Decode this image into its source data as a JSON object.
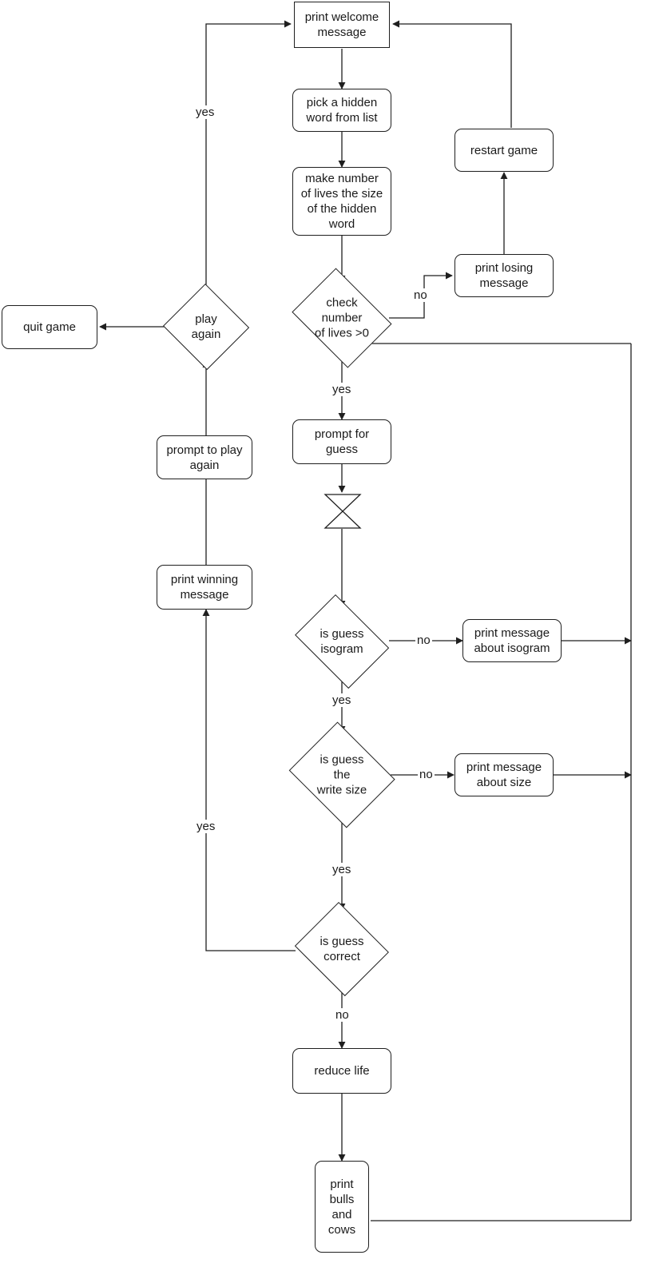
{
  "diagram": {
    "title": "Word guessing game flowchart",
    "stroke_color": "#1f1f1f",
    "text_color": "#1a1a1a",
    "background_color": "#ffffff"
  },
  "nodes": {
    "welcome": {
      "label": "print welcome\nmessage",
      "shape": "rectangle"
    },
    "pick_word": {
      "label": "pick a hidden\nword from list",
      "shape": "rounded-rectangle"
    },
    "set_lives": {
      "label": "make number\nof lives the size\nof the hidden\nword",
      "shape": "rounded-rectangle"
    },
    "check_lives": {
      "label": "check number\nof lives >0",
      "shape": "decision"
    },
    "print_losing": {
      "label": "print losing\nmessage",
      "shape": "rounded-rectangle"
    },
    "restart_game": {
      "label": "restart game",
      "shape": "rounded-rectangle"
    },
    "play_again": {
      "label": "play again",
      "shape": "decision"
    },
    "quit_game": {
      "label": "quit game",
      "shape": "rounded-rectangle"
    },
    "prompt_play": {
      "label": "prompt to play\nagain",
      "shape": "rounded-rectangle"
    },
    "print_winning": {
      "label": "print winning\nmessage",
      "shape": "rounded-rectangle"
    },
    "prompt_guess": {
      "label": "prompt for\nguess",
      "shape": "rounded-rectangle"
    },
    "input_guess": {
      "label": "",
      "shape": "hourglass"
    },
    "is_isogram": {
      "label": "is guess\nisogram",
      "shape": "decision"
    },
    "msg_isogram": {
      "label": "print message\nabout isogram",
      "shape": "rounded-rectangle"
    },
    "is_right_size": {
      "label": "is guess the\nwrite size",
      "shape": "decision"
    },
    "msg_size": {
      "label": "print message\nabout size",
      "shape": "rounded-rectangle"
    },
    "is_correct": {
      "label": "is guess\ncorrect",
      "shape": "decision"
    },
    "reduce_life": {
      "label": "reduce life",
      "shape": "rounded-rectangle"
    },
    "bulls_cows": {
      "label": "print\nbulls\nand\ncows",
      "shape": "rounded-rectangle"
    }
  },
  "edge_labels": {
    "play_again_yes": "yes",
    "check_lives_no": "no",
    "check_lives_yes": "yes",
    "isogram_no": "no",
    "isogram_yes": "yes",
    "size_no": "no",
    "size_yes": "yes",
    "correct_no": "no",
    "correct_yes": "yes"
  }
}
